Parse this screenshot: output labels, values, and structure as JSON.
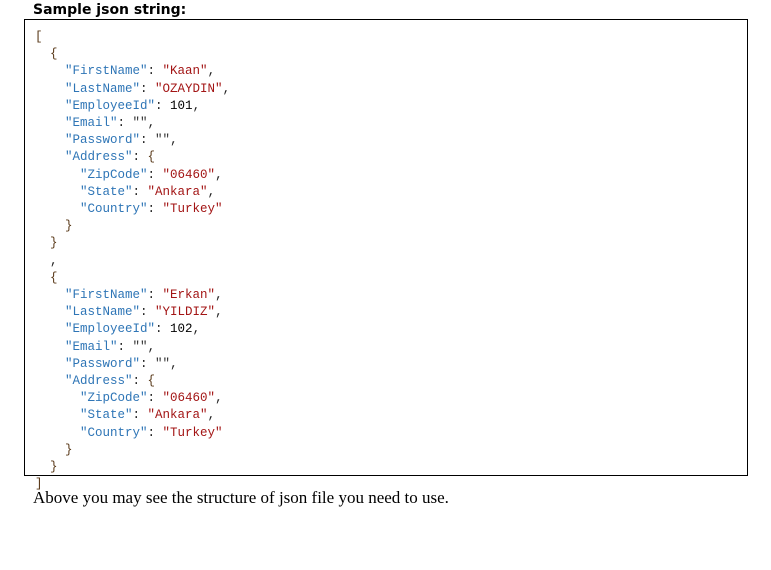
{
  "title": "Sample json string:",
  "note": "Above you may see the structure of json file you need to use.",
  "code_lines": [
    {
      "indent": 0,
      "tokens": [
        {
          "t": "[",
          "c": "b"
        }
      ]
    },
    {
      "indent": 1,
      "tokens": [
        {
          "t": "{",
          "c": "b"
        }
      ]
    },
    {
      "indent": 2,
      "tokens": [
        {
          "t": "\"FirstName\"",
          "c": "k"
        },
        {
          "t": ": ",
          "c": "p"
        },
        {
          "t": "\"Kaan\"",
          "c": "s"
        },
        {
          "t": ",",
          "c": "p"
        }
      ]
    },
    {
      "indent": 2,
      "tokens": [
        {
          "t": "\"LastName\"",
          "c": "k"
        },
        {
          "t": ": ",
          "c": "p"
        },
        {
          "t": "\"OZAYDIN\"",
          "c": "s"
        },
        {
          "t": ",",
          "c": "p"
        }
      ]
    },
    {
      "indent": 2,
      "tokens": [
        {
          "t": "\"EmployeeId\"",
          "c": "k"
        },
        {
          "t": ": ",
          "c": "p"
        },
        {
          "t": "101",
          "c": "n"
        },
        {
          "t": ",",
          "c": "p"
        }
      ]
    },
    {
      "indent": 2,
      "tokens": [
        {
          "t": "\"Email\"",
          "c": "k"
        },
        {
          "t": ": ",
          "c": "p"
        },
        {
          "t": "\"\"",
          "c": "e"
        },
        {
          "t": ",",
          "c": "p"
        }
      ]
    },
    {
      "indent": 2,
      "tokens": [
        {
          "t": "\"Password\"",
          "c": "k"
        },
        {
          "t": ": ",
          "c": "p"
        },
        {
          "t": "\"\"",
          "c": "e"
        },
        {
          "t": ",",
          "c": "p"
        }
      ]
    },
    {
      "indent": 2,
      "tokens": [
        {
          "t": "\"Address\"",
          "c": "k"
        },
        {
          "t": ": ",
          "c": "p"
        },
        {
          "t": "{",
          "c": "b"
        }
      ]
    },
    {
      "indent": 3,
      "tokens": [
        {
          "t": "\"ZipCode\"",
          "c": "k"
        },
        {
          "t": ": ",
          "c": "p"
        },
        {
          "t": "\"06460\"",
          "c": "s"
        },
        {
          "t": ",",
          "c": "p"
        }
      ]
    },
    {
      "indent": 3,
      "tokens": [
        {
          "t": "\"State\"",
          "c": "k"
        },
        {
          "t": ": ",
          "c": "p"
        },
        {
          "t": "\"Ankara\"",
          "c": "s"
        },
        {
          "t": ",",
          "c": "p"
        }
      ]
    },
    {
      "indent": 3,
      "tokens": [
        {
          "t": "\"Country\"",
          "c": "k"
        },
        {
          "t": ": ",
          "c": "p"
        },
        {
          "t": "\"Turkey\"",
          "c": "s"
        }
      ]
    },
    {
      "indent": 2,
      "tokens": [
        {
          "t": "}",
          "c": "b"
        }
      ]
    },
    {
      "indent": 1,
      "tokens": [
        {
          "t": "}",
          "c": "b"
        }
      ]
    },
    {
      "indent": 1,
      "tokens": [
        {
          "t": ",",
          "c": "p"
        }
      ]
    },
    {
      "indent": 1,
      "tokens": [
        {
          "t": "{",
          "c": "b"
        }
      ]
    },
    {
      "indent": 2,
      "tokens": [
        {
          "t": "\"FirstName\"",
          "c": "k"
        },
        {
          "t": ": ",
          "c": "p"
        },
        {
          "t": "\"Erkan\"",
          "c": "s"
        },
        {
          "t": ",",
          "c": "p"
        }
      ]
    },
    {
      "indent": 2,
      "tokens": [
        {
          "t": "\"LastName\"",
          "c": "k"
        },
        {
          "t": ": ",
          "c": "p"
        },
        {
          "t": "\"YILDIZ\"",
          "c": "s"
        },
        {
          "t": ",",
          "c": "p"
        }
      ]
    },
    {
      "indent": 2,
      "tokens": [
        {
          "t": "\"EmployeeId\"",
          "c": "k"
        },
        {
          "t": ": ",
          "c": "p"
        },
        {
          "t": "102",
          "c": "n"
        },
        {
          "t": ",",
          "c": "p"
        }
      ]
    },
    {
      "indent": 2,
      "tokens": [
        {
          "t": "\"Email\"",
          "c": "k"
        },
        {
          "t": ": ",
          "c": "p"
        },
        {
          "t": "\"\"",
          "c": "e"
        },
        {
          "t": ",",
          "c": "p"
        }
      ]
    },
    {
      "indent": 2,
      "tokens": [
        {
          "t": "\"Password\"",
          "c": "k"
        },
        {
          "t": ": ",
          "c": "p"
        },
        {
          "t": "\"\"",
          "c": "e"
        },
        {
          "t": ",",
          "c": "p"
        }
      ]
    },
    {
      "indent": 2,
      "tokens": [
        {
          "t": "\"Address\"",
          "c": "k"
        },
        {
          "t": ": ",
          "c": "p"
        },
        {
          "t": "{",
          "c": "b"
        }
      ]
    },
    {
      "indent": 3,
      "tokens": [
        {
          "t": "\"ZipCode\"",
          "c": "k"
        },
        {
          "t": ": ",
          "c": "p"
        },
        {
          "t": "\"06460\"",
          "c": "s"
        },
        {
          "t": ",",
          "c": "p"
        }
      ]
    },
    {
      "indent": 3,
      "tokens": [
        {
          "t": "\"State\"",
          "c": "k"
        },
        {
          "t": ": ",
          "c": "p"
        },
        {
          "t": "\"Ankara\"",
          "c": "s"
        },
        {
          "t": ",",
          "c": "p"
        }
      ]
    },
    {
      "indent": 3,
      "tokens": [
        {
          "t": "\"Country\"",
          "c": "k"
        },
        {
          "t": ": ",
          "c": "p"
        },
        {
          "t": "\"Turkey\"",
          "c": "s"
        }
      ]
    },
    {
      "indent": 2,
      "tokens": [
        {
          "t": "}",
          "c": "b"
        }
      ]
    },
    {
      "indent": 1,
      "tokens": [
        {
          "t": "}",
          "c": "b"
        }
      ]
    },
    {
      "indent": 0,
      "tokens": [
        {
          "t": "]",
          "c": "b"
        }
      ]
    }
  ]
}
